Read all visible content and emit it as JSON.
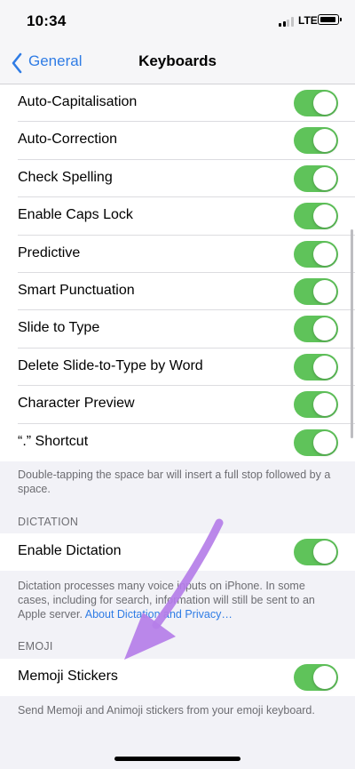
{
  "status_bar": {
    "time": "10:34",
    "network": "LTE",
    "signal_icon": "signal-icon",
    "battery_icon": "battery-icon"
  },
  "nav": {
    "back_label": "General",
    "title": "Keyboards"
  },
  "keyboard_settings": {
    "rows": [
      {
        "label": "Auto-Capitalisation",
        "on": true
      },
      {
        "label": "Auto-Correction",
        "on": true
      },
      {
        "label": "Check Spelling",
        "on": true
      },
      {
        "label": "Enable Caps Lock",
        "on": true
      },
      {
        "label": "Predictive",
        "on": true
      },
      {
        "label": "Smart Punctuation",
        "on": true
      },
      {
        "label": "Slide to Type",
        "on": true
      },
      {
        "label": "Delete Slide-to-Type by Word",
        "on": true
      },
      {
        "label": "Character Preview",
        "on": true
      },
      {
        "label": "“.” Shortcut",
        "on": true
      }
    ],
    "footer": "Double-tapping the space bar will insert a full stop followed by a space."
  },
  "dictation": {
    "header": "DICTATION",
    "row": {
      "label": "Enable Dictation",
      "on": true
    },
    "footer": "Dictation processes many voice inputs on iPhone. In some cases, including for search, information will still be sent to an Apple server.",
    "link": "About Dictation and Privacy…"
  },
  "emoji": {
    "header": "EMOJI",
    "row": {
      "label": "Memoji Stickers",
      "on": true
    },
    "footer": "Send Memoji and Animoji stickers from your emoji keyboard."
  },
  "colors": {
    "accent": "#2f7ce5",
    "toggle_on": "#5fc35a",
    "background": "#f2f2f7",
    "annotation": "#b57ee8"
  }
}
